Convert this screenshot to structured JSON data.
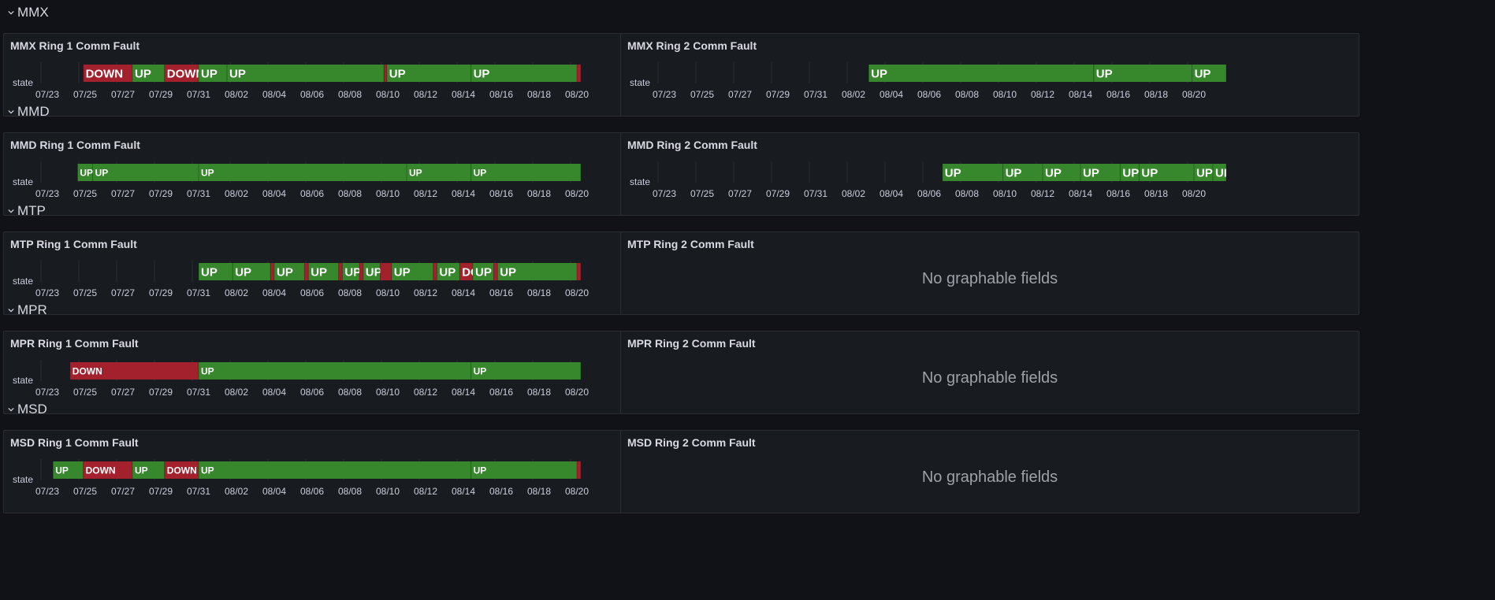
{
  "palette": {
    "up": "#37872d",
    "down": "#a3202d",
    "grid": "#2b2e34",
    "text": "#ffffff",
    "axis": "#ccccdc"
  },
  "icons": {
    "collapse": "chevron-down-icon"
  },
  "state_label": "state",
  "no_data_text": "No graphable fields",
  "ticks": [
    "07/23",
    "07/25",
    "07/27",
    "07/29",
    "07/31",
    "08/02",
    "08/04",
    "08/06",
    "08/08",
    "08/10",
    "08/12",
    "08/14",
    "08/16",
    "08/18",
    "08/20"
  ],
  "rows": [
    {
      "title": "MMX",
      "panels": [
        {
          "title": "MMX Ring 1 Comm Fault",
          "label_size": 15,
          "segments": [
            {
              "start": 24.9,
              "end": 27.5,
              "state": "down",
              "label": "DOWN"
            },
            {
              "start": 27.5,
              "end": 29.2,
              "state": "up",
              "label": "UP"
            },
            {
              "start": 29.2,
              "end": 31.0,
              "state": "down",
              "label": "DOWN"
            },
            {
              "start": 31.0,
              "end": 32.5,
              "state": "up",
              "label": "UP"
            },
            {
              "start": 32.5,
              "end": 40.8,
              "state": "up",
              "label": "UP"
            },
            {
              "start": 40.8,
              "end": 40.95,
              "state": "down",
              "label": ""
            },
            {
              "start": 40.95,
              "end": 45.4,
              "state": "up",
              "label": "UP"
            },
            {
              "start": 45.4,
              "end": 51.0,
              "state": "up",
              "label": "UP"
            },
            {
              "start": 51.0,
              "end": 51.2,
              "state": "down",
              "label": ""
            }
          ]
        },
        {
          "title": "MMX Ring 2 Comm Fault",
          "label_size": 15,
          "segments": [
            {
              "start": 33.8,
              "end": 45.7,
              "state": "up",
              "label": "UP"
            },
            {
              "start": 45.7,
              "end": 50.9,
              "state": "up",
              "label": "UP"
            },
            {
              "start": 50.9,
              "end": 52.7,
              "state": "up",
              "label": "UP"
            }
          ]
        }
      ]
    },
    {
      "title": "MMD",
      "panels": [
        {
          "title": "MMD Ring 1 Comm Fault",
          "label_size": 12,
          "segments": [
            {
              "start": 24.6,
              "end": 25.4,
              "state": "up",
              "label": "UP"
            },
            {
              "start": 25.4,
              "end": 31.0,
              "state": "up",
              "label": "UP"
            },
            {
              "start": 31.0,
              "end": 42.0,
              "state": "up",
              "label": "UP"
            },
            {
              "start": 42.0,
              "end": 45.4,
              "state": "up",
              "label": "UP"
            },
            {
              "start": 45.4,
              "end": 51.2,
              "state": "up",
              "label": "UP"
            }
          ]
        },
        {
          "title": "MMD Ring 2 Comm Fault",
          "label_size": 15,
          "segments": [
            {
              "start": 37.7,
              "end": 40.9,
              "state": "up",
              "label": "UP"
            },
            {
              "start": 40.9,
              "end": 43.0,
              "state": "up",
              "label": "UP"
            },
            {
              "start": 43.0,
              "end": 45.0,
              "state": "up",
              "label": "UP"
            },
            {
              "start": 45.0,
              "end": 47.1,
              "state": "up",
              "label": "UP"
            },
            {
              "start": 47.1,
              "end": 48.1,
              "state": "up",
              "label": "UP"
            },
            {
              "start": 48.1,
              "end": 51.0,
              "state": "up",
              "label": "UP"
            },
            {
              "start": 51.0,
              "end": 52.0,
              "state": "up",
              "label": "UP"
            },
            {
              "start": 52.0,
              "end": 52.7,
              "state": "up",
              "label": "UP"
            }
          ]
        }
      ]
    },
    {
      "title": "MTP",
      "panels": [
        {
          "title": "MTP Ring 1 Comm Fault",
          "label_size": 15,
          "segments": [
            {
              "start": 31.0,
              "end": 32.8,
              "state": "up",
              "label": "UP"
            },
            {
              "start": 32.8,
              "end": 34.8,
              "state": "up",
              "label": "UP"
            },
            {
              "start": 34.8,
              "end": 35.0,
              "state": "down",
              "label": ""
            },
            {
              "start": 35.0,
              "end": 36.6,
              "state": "up",
              "label": "UP"
            },
            {
              "start": 36.6,
              "end": 36.8,
              "state": "down",
              "label": ""
            },
            {
              "start": 36.8,
              "end": 38.4,
              "state": "up",
              "label": "UP"
            },
            {
              "start": 38.4,
              "end": 38.6,
              "state": "down",
              "label": ""
            },
            {
              "start": 38.6,
              "end": 39.5,
              "state": "up",
              "label": "UP"
            },
            {
              "start": 39.5,
              "end": 39.7,
              "state": "down",
              "label": ""
            },
            {
              "start": 39.7,
              "end": 40.6,
              "state": "up",
              "label": "UP"
            },
            {
              "start": 40.6,
              "end": 41.2,
              "state": "down",
              "label": ""
            },
            {
              "start": 41.2,
              "end": 43.4,
              "state": "up",
              "label": "UP"
            },
            {
              "start": 43.4,
              "end": 43.6,
              "state": "down",
              "label": ""
            },
            {
              "start": 43.6,
              "end": 44.8,
              "state": "up",
              "label": "UP"
            },
            {
              "start": 44.8,
              "end": 45.5,
              "state": "down",
              "label": "DOWN"
            },
            {
              "start": 45.5,
              "end": 46.6,
              "state": "up",
              "label": "UP"
            },
            {
              "start": 46.6,
              "end": 46.8,
              "state": "down",
              "label": ""
            },
            {
              "start": 46.8,
              "end": 51.0,
              "state": "up",
              "label": "UP"
            },
            {
              "start": 51.0,
              "end": 51.2,
              "state": "down",
              "label": ""
            }
          ]
        },
        {
          "title": "MTP Ring 2 Comm Fault",
          "no_data": true
        }
      ]
    },
    {
      "title": "MPR",
      "panels": [
        {
          "title": "MPR Ring 1 Comm Fault",
          "label_size": 12,
          "segments": [
            {
              "start": 24.2,
              "end": 31.0,
              "state": "down",
              "label": "DOWN"
            },
            {
              "start": 31.0,
              "end": 45.4,
              "state": "up",
              "label": "UP"
            },
            {
              "start": 45.4,
              "end": 51.2,
              "state": "up",
              "label": "UP"
            }
          ]
        },
        {
          "title": "MPR Ring 2 Comm Fault",
          "no_data": true
        }
      ]
    },
    {
      "title": "MSD",
      "panels": [
        {
          "title": "MSD Ring 1 Comm Fault",
          "label_size": 12,
          "segments": [
            {
              "start": 23.3,
              "end": 24.9,
              "state": "up",
              "label": "UP"
            },
            {
              "start": 24.9,
              "end": 27.5,
              "state": "down",
              "label": "DOWN"
            },
            {
              "start": 27.5,
              "end": 29.2,
              "state": "up",
              "label": "UP"
            },
            {
              "start": 29.2,
              "end": 31.0,
              "state": "down",
              "label": "DOWN"
            },
            {
              "start": 31.0,
              "end": 45.4,
              "state": "up",
              "label": "UP"
            },
            {
              "start": 45.4,
              "end": 51.0,
              "state": "up",
              "label": "UP"
            },
            {
              "start": 51.0,
              "end": 51.2,
              "state": "down",
              "label": ""
            }
          ]
        },
        {
          "title": "MSD Ring 2 Comm Fault",
          "no_data": true
        }
      ]
    }
  ]
}
